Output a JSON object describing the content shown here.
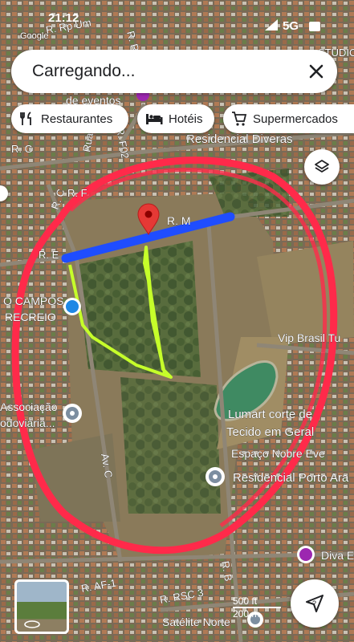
{
  "status_bar": {
    "time": "21:12",
    "google_label": "Google",
    "network": "5G"
  },
  "search": {
    "text": "Carregando..."
  },
  "chips": [
    {
      "label": "Restaurantes",
      "icon": "fork-knife-icon"
    },
    {
      "label": "Hotéis",
      "icon": "bed-icon"
    },
    {
      "label": "Supermercados",
      "icon": "cart-icon"
    }
  ],
  "map": {
    "streets": {
      "r_rp_um": "R. Rp Um",
      "r_rp_d": "R. Rp D",
      "rua_f1": "Rua F1",
      "r_f02": "R. F02",
      "r_g": "R. G",
      "r_f": "R. F",
      "r_e": "R. E",
      "r_m": "R. M",
      "r_c": "R. C",
      "av_c": "Av. C",
      "r_b": "R. B",
      "r_af1": "R. AF-1",
      "r_rsc3": "R. RSC 3"
    },
    "places": {
      "de_eventos": "de eventos",
      "residencial_diveras": "Residencial Diveras",
      "campos_recreio": "O CAMPOS\nRECREIO",
      "vip_brasil": "Vip Brasil Tu",
      "associacao": "Associação\nodoviária...",
      "lumart": "Lumart corte de\nTecido em Geral",
      "espaco_nobre": "Espaço Nobre Eve",
      "residencial_porto": "Residencial Porto Ara",
      "diva": "Diva E",
      "satelite_norte": "Satélite Norte",
      "studio_top": "STUDIO"
    },
    "colors": {
      "red_circle": "#ff2a4a",
      "blue_line": "#1f4dff",
      "green_outline": "#c6ff2a",
      "pin": "#e53935"
    }
  },
  "scale": {
    "ft": "500 ft",
    "m": "200 m"
  }
}
